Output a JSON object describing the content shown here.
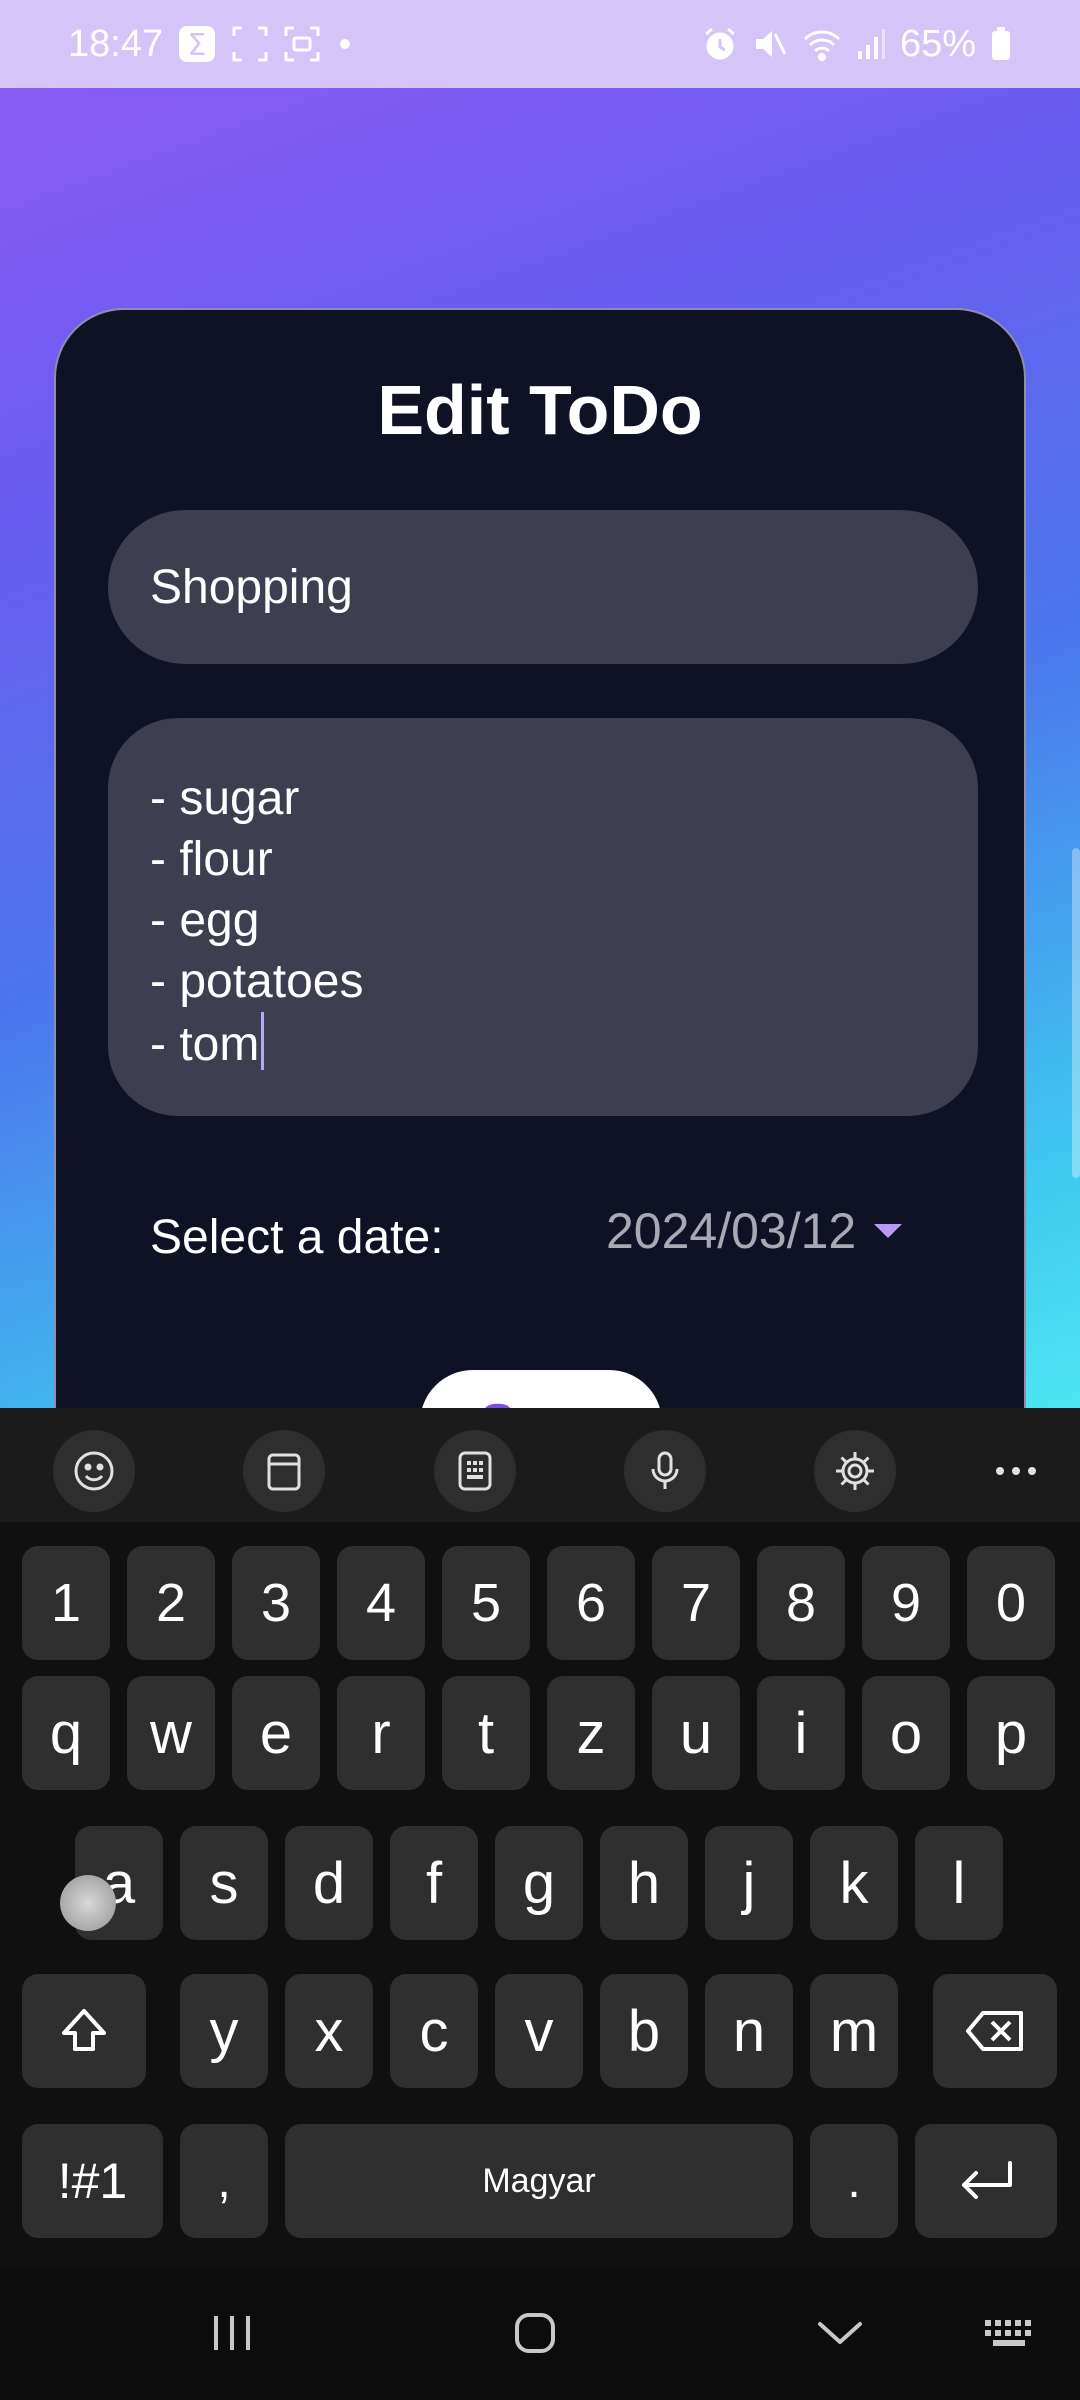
{
  "status_bar": {
    "time": "18:47",
    "battery": "65%",
    "left_icons": [
      "sigma-icon",
      "screenshot-frame-icon",
      "screen-record-icon",
      "dot-icon"
    ],
    "right_icons": [
      "alarm-icon",
      "mute-icon",
      "wifi-icon",
      "signal-icon",
      "battery-icon"
    ]
  },
  "dialog": {
    "title": "Edit ToDo",
    "title_value": "Shopping",
    "description_value": "- sugar\n- flour\n- egg\n- potatoes\n- tom",
    "date_label": "Select a date:",
    "date_value": "2024/03/12",
    "save_label": "Save"
  },
  "keyboard": {
    "toolbar": [
      "emoji-icon",
      "clipboard-icon",
      "keypad-icon",
      "microphone-icon",
      "settings-icon",
      "more-icon"
    ],
    "row_numbers": [
      "1",
      "2",
      "3",
      "4",
      "5",
      "6",
      "7",
      "8",
      "9",
      "0"
    ],
    "row_top": [
      "q",
      "w",
      "e",
      "r",
      "t",
      "z",
      "u",
      "i",
      "o",
      "p"
    ],
    "row_middle": [
      "a",
      "s",
      "d",
      "f",
      "g",
      "h",
      "j",
      "k",
      "l"
    ],
    "row_bottom": [
      "y",
      "x",
      "c",
      "v",
      "b",
      "n",
      "m"
    ],
    "symbols_label": "!#1",
    "comma_label": ",",
    "space_label": "Magyar",
    "period_label": "."
  },
  "nav_bar": [
    "recents-icon",
    "home-icon",
    "back-icon",
    "keyboard-switch-icon"
  ],
  "colors": {
    "accent": "#7a4fe0",
    "card_background": "#0f1124",
    "field_background": "#3d3e50",
    "status_bar": "#d4c4f7"
  }
}
